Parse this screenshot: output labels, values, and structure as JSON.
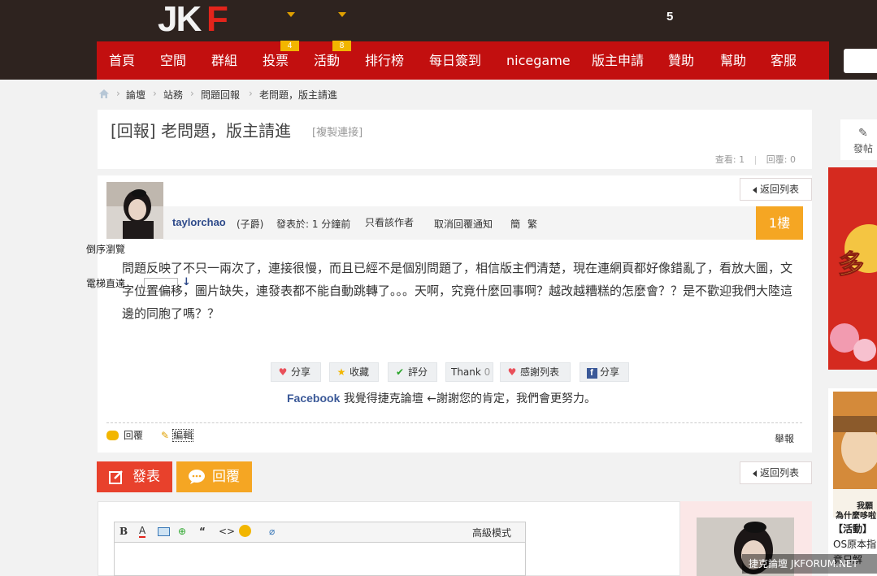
{
  "header": {
    "logo_text": "JKF",
    "notification_count": "5"
  },
  "nav": {
    "items": [
      {
        "label": "首頁"
      },
      {
        "label": "空間"
      },
      {
        "label": "群組"
      },
      {
        "label": "投票",
        "badge": "4"
      },
      {
        "label": "活動",
        "badge": "8"
      },
      {
        "label": "排行榜"
      },
      {
        "label": "每日簽到"
      },
      {
        "label": "nicegame"
      },
      {
        "label": "版主申請"
      },
      {
        "label": "贊助"
      },
      {
        "label": "幫助"
      },
      {
        "label": "客服"
      }
    ]
  },
  "breadcrumb": {
    "items": [
      "論壇",
      "站務",
      "問題回報",
      "老問題，版主請進"
    ]
  },
  "thread": {
    "title": "[回報] 老問題，版主請進",
    "copy_link": "[複製連接]",
    "views_label": "查看: 1",
    "stats_sep": "|",
    "replies_label": "回覆: 0",
    "back_label": "返回列表"
  },
  "post": {
    "author": "taylorchao",
    "rank": "(子爵)",
    "posted": "發表於: 1 分鐘前",
    "only_author": "只看該作者",
    "cancel_notify": "取消回覆通知",
    "simp": "簡",
    "trad": "繁",
    "floor": "1樓",
    "reverse_browse": "倒序瀏覽",
    "elevator": "電梯直達",
    "body": "問題反映了不只一兩次了，連接很慢，而且已經不是個別問題了，相信版主們清楚，現在連網頁都好像錯亂了，看放大圖，文字位置偏移，圖片缺失，連發表都不能自動跳轉了。。。天啊，究竟什麼回事啊？越改越糟糕的怎麼會？？是不歡迎我們大陸這邊的同胞了嗎？？",
    "actions": {
      "share": "分享",
      "favorite": "收藏",
      "rate": "評分",
      "thank": "Thank",
      "thank_count": "0",
      "thanks_list": "感謝列表",
      "fb_share": "分享"
    },
    "facebook_line_brand": "Facebook",
    "facebook_line_text": "我覺得捷克論壇 ←謝謝您的肯定，我們會更努力。",
    "reply": "回覆",
    "edit": "編輯",
    "report": "舉報"
  },
  "bottom": {
    "post_button": "發表",
    "reply_button": "回覆",
    "advanced_mode": "高級模式"
  },
  "sidebar": {
    "post_label": "發帖",
    "ad_caption_1": "我願",
    "ad_caption_2": "為什麼哆啦",
    "activity_label": "【活動】",
    "os_label": "OS原本指",
    "line3": "竟日解"
  },
  "watermark": "捷克論壇 JKFORUM.NET",
  "colors": {
    "topbar": "#2e231f",
    "nav": "#c20f0f",
    "badge": "#f2b600",
    "floor": "#f5a623",
    "post_btn": "#e8412c"
  }
}
